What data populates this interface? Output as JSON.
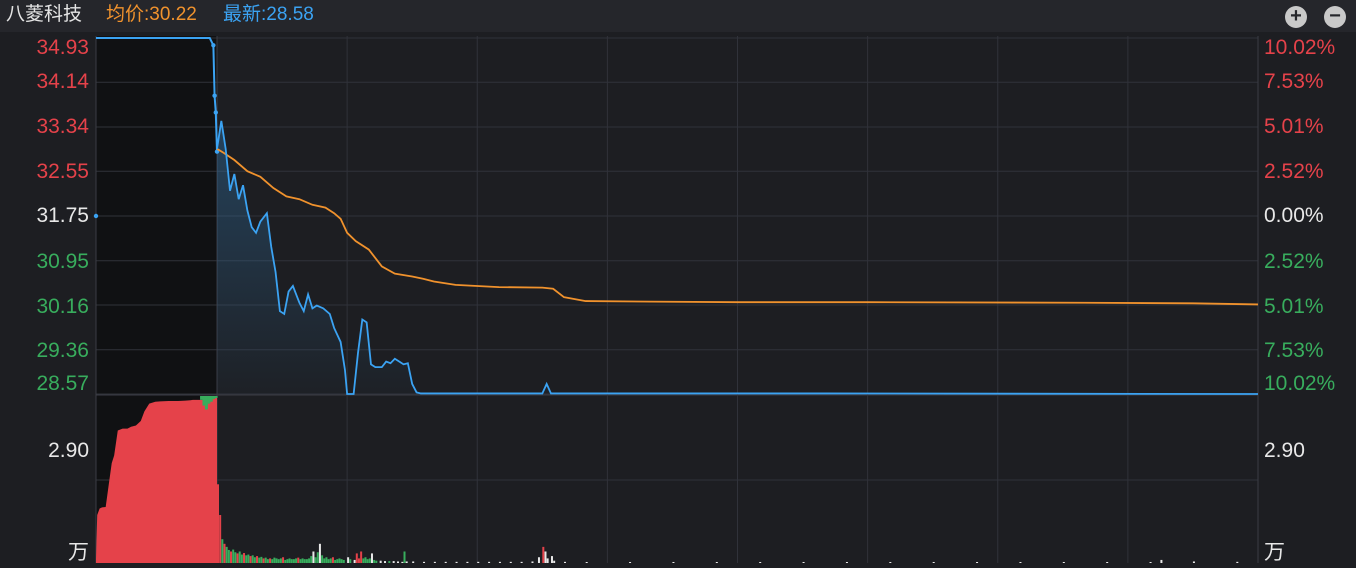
{
  "header": {
    "stock_name": "八菱科技",
    "avg_text": "均价:30.22",
    "latest_text": "最新:28.58",
    "zoom_in_symbol": "+",
    "zoom_out_symbol": "−"
  },
  "colors": {
    "background": "#1d1e22",
    "header_bg": "#25262b",
    "price_line": "#3ba3f3",
    "avg_line": "#f0922d",
    "up": "#e5424a",
    "down": "#38ad5d",
    "neutral_text": "#e8e8e8",
    "grid": "#30323a"
  },
  "chart_data": {
    "type": "line",
    "title": "",
    "ylim": [
      28.57,
      34.93
    ],
    "prev_close": 31.75,
    "price_ticks": [
      "34.93",
      "34.14",
      "33.34",
      "32.55",
      "31.75",
      "30.95",
      "30.16",
      "29.36",
      "28.57"
    ],
    "pct_ticks": [
      "10.02%",
      "7.53%",
      "5.01%",
      "2.52%",
      "0.00%",
      "2.52%",
      "5.01%",
      "7.53%",
      "10.02%"
    ],
    "volume_tick": "2.90",
    "volume_unit": "万",
    "pre_market": {
      "price_points": [
        [
          0,
          34.93
        ],
        [
          94,
          34.93
        ],
        [
          97,
          34.8
        ],
        [
          98,
          33.9
        ],
        [
          99,
          33.6
        ],
        [
          100,
          32.9
        ]
      ]
    },
    "series": [
      {
        "name": "最新",
        "points": [
          [
            0,
            32.95
          ],
          [
            2,
            33.45
          ],
          [
            4,
            32.95
          ],
          [
            6,
            32.2
          ],
          [
            8,
            32.5
          ],
          [
            10,
            32.05
          ],
          [
            12,
            32.3
          ],
          [
            14,
            31.85
          ],
          [
            16,
            31.55
          ],
          [
            18,
            31.45
          ],
          [
            20,
            31.65
          ],
          [
            23,
            31.8
          ],
          [
            25,
            31.2
          ],
          [
            27,
            30.75
          ],
          [
            29,
            30.05
          ],
          [
            31,
            30.0
          ],
          [
            33,
            30.4
          ],
          [
            35,
            30.5
          ],
          [
            37,
            30.3
          ],
          [
            38,
            30.2
          ],
          [
            40,
            30.05
          ],
          [
            42,
            30.35
          ],
          [
            44,
            30.1
          ],
          [
            46,
            30.15
          ],
          [
            49,
            30.1
          ],
          [
            52,
            30.0
          ],
          [
            54,
            29.75
          ],
          [
            57,
            29.5
          ],
          [
            59,
            29.0
          ],
          [
            60,
            28.57
          ],
          [
            63,
            28.57
          ],
          [
            65,
            29.3
          ],
          [
            67,
            29.9
          ],
          [
            69,
            29.85
          ],
          [
            71,
            29.1
          ],
          [
            73,
            29.05
          ],
          [
            76,
            29.05
          ],
          [
            78,
            29.15
          ],
          [
            80,
            29.12
          ],
          [
            82,
            29.2
          ],
          [
            84,
            29.15
          ],
          [
            86,
            29.1
          ],
          [
            88,
            29.12
          ],
          [
            90,
            28.75
          ],
          [
            92,
            28.6
          ],
          [
            94,
            28.58
          ],
          [
            150,
            28.58
          ],
          [
            152,
            28.75
          ],
          [
            154,
            28.58
          ],
          [
            278,
            28.58
          ],
          [
            480,
            28.57
          ]
        ]
      },
      {
        "name": "均价",
        "points": [
          [
            0,
            32.95
          ],
          [
            3,
            32.88
          ],
          [
            8,
            32.75
          ],
          [
            14,
            32.55
          ],
          [
            20,
            32.45
          ],
          [
            26,
            32.25
          ],
          [
            32,
            32.1
          ],
          [
            38,
            32.05
          ],
          [
            44,
            31.95
          ],
          [
            50,
            31.9
          ],
          [
            54,
            31.8
          ],
          [
            57,
            31.7
          ],
          [
            60,
            31.45
          ],
          [
            64,
            31.3
          ],
          [
            70,
            31.15
          ],
          [
            76,
            30.85
          ],
          [
            82,
            30.72
          ],
          [
            90,
            30.67
          ],
          [
            95,
            30.63
          ],
          [
            100,
            30.58
          ],
          [
            110,
            30.52
          ],
          [
            130,
            30.48
          ],
          [
            150,
            30.47
          ],
          [
            155,
            30.45
          ],
          [
            160,
            30.3
          ],
          [
            170,
            30.23
          ],
          [
            200,
            30.22
          ],
          [
            240,
            30.21
          ],
          [
            300,
            30.21
          ],
          [
            400,
            30.2
          ],
          [
            450,
            30.19
          ],
          [
            480,
            30.17
          ]
        ]
      }
    ],
    "volume": {
      "preauction_imbalance": [
        [
          0,
          0.1
        ],
        [
          1,
          1.25
        ],
        [
          3,
          1.42
        ],
        [
          5,
          1.45
        ],
        [
          8,
          1.46
        ],
        [
          11,
          2.15
        ],
        [
          13,
          2.6
        ],
        [
          15,
          2.8
        ],
        [
          18,
          3.45
        ],
        [
          22,
          3.5
        ],
        [
          26,
          3.5
        ],
        [
          29,
          3.55
        ],
        [
          33,
          3.58
        ],
        [
          37,
          3.7
        ],
        [
          40,
          3.95
        ],
        [
          44,
          4.15
        ],
        [
          49,
          4.2
        ],
        [
          53,
          4.21
        ],
        [
          60,
          4.22
        ],
        [
          68,
          4.22
        ],
        [
          74,
          4.23
        ],
        [
          78,
          4.24
        ],
        [
          80,
          4.25
        ],
        [
          84,
          4.25
        ],
        [
          88,
          4.25
        ],
        [
          90,
          4.2
        ],
        [
          92,
          4.3
        ],
        [
          94,
          4.25
        ],
        [
          96,
          4.35
        ],
        [
          100,
          4.35
        ]
      ],
      "preauction_green": [
        [
          86,
          0.1
        ],
        [
          88,
          0.25
        ],
        [
          90,
          0.35
        ],
        [
          92,
          0.2
        ],
        [
          94,
          0.15
        ],
        [
          96,
          0.08
        ],
        [
          98,
          0.05
        ]
      ],
      "bars": [
        {
          "t": 0,
          "v": 2.05,
          "dir": "up"
        },
        {
          "t": 1,
          "v": 1.25,
          "dir": "up"
        },
        {
          "t": 2,
          "v": 0.62,
          "dir": "down"
        },
        {
          "t": 3,
          "v": 0.5,
          "dir": "up"
        },
        {
          "t": 4,
          "v": 0.42,
          "dir": "down"
        },
        {
          "t": 5,
          "v": 0.34,
          "dir": "down"
        },
        {
          "t": 6,
          "v": 0.3,
          "dir": "up"
        },
        {
          "t": 7,
          "v": 0.35,
          "dir": "down"
        },
        {
          "t": 8,
          "v": 0.28,
          "dir": "down"
        },
        {
          "t": 9,
          "v": 0.25,
          "dir": "up"
        },
        {
          "t": 10,
          "v": 0.3,
          "dir": "down"
        },
        {
          "t": 11,
          "v": 0.22,
          "dir": "down"
        },
        {
          "t": 12,
          "v": 0.26,
          "dir": "up"
        },
        {
          "t": 13,
          "v": 0.2,
          "dir": "down"
        },
        {
          "t": 14,
          "v": 0.22,
          "dir": "down"
        },
        {
          "t": 15,
          "v": 0.18,
          "dir": "up"
        },
        {
          "t": 16,
          "v": 0.2,
          "dir": "down"
        },
        {
          "t": 17,
          "v": 0.15,
          "dir": "down"
        },
        {
          "t": 18,
          "v": 0.18,
          "dir": "up"
        },
        {
          "t": 19,
          "v": 0.14,
          "dir": "down"
        },
        {
          "t": 20,
          "v": 0.16,
          "dir": "down"
        },
        {
          "t": 21,
          "v": 0.12,
          "dir": "up"
        },
        {
          "t": 22,
          "v": 0.14,
          "dir": "down"
        },
        {
          "t": 23,
          "v": 0.1,
          "dir": "down"
        },
        {
          "t": 24,
          "v": 0.12,
          "dir": "up"
        },
        {
          "t": 25,
          "v": 0.1,
          "dir": "down"
        },
        {
          "t": 26,
          "v": 0.14,
          "dir": "down"
        },
        {
          "t": 27,
          "v": 0.12,
          "dir": "down"
        },
        {
          "t": 28,
          "v": 0.1,
          "dir": "down"
        },
        {
          "t": 29,
          "v": 0.12,
          "dir": "down"
        },
        {
          "t": 30,
          "v": 0.15,
          "dir": "up"
        },
        {
          "t": 31,
          "v": 0.08,
          "dir": "down"
        },
        {
          "t": 32,
          "v": 0.1,
          "dir": "down"
        },
        {
          "t": 33,
          "v": 0.12,
          "dir": "down"
        },
        {
          "t": 34,
          "v": 0.1,
          "dir": "down"
        },
        {
          "t": 35,
          "v": 0.1,
          "dir": "down"
        },
        {
          "t": 36,
          "v": 0.12,
          "dir": "down"
        },
        {
          "t": 37,
          "v": 0.14,
          "dir": "up"
        },
        {
          "t": 38,
          "v": 0.1,
          "dir": "down"
        },
        {
          "t": 39,
          "v": 0.12,
          "dir": "down"
        },
        {
          "t": 40,
          "v": 0.1,
          "dir": "down"
        },
        {
          "t": 41,
          "v": 0.1,
          "dir": "down"
        },
        {
          "t": 42,
          "v": 0.12,
          "dir": "down"
        },
        {
          "t": 43,
          "v": 0.18,
          "dir": "down"
        },
        {
          "t": 44,
          "v": 0.3,
          "dir": "flat"
        },
        {
          "t": 45,
          "v": 0.15,
          "dir": "down"
        },
        {
          "t": 46,
          "v": 0.28,
          "dir": "down"
        },
        {
          "t": 47,
          "v": 0.5,
          "dir": "flat"
        },
        {
          "t": 48,
          "v": 0.2,
          "dir": "down"
        },
        {
          "t": 49,
          "v": 0.12,
          "dir": "down"
        },
        {
          "t": 50,
          "v": 0.15,
          "dir": "down"
        },
        {
          "t": 51,
          "v": 0.1,
          "dir": "down"
        },
        {
          "t": 52,
          "v": 0.12,
          "dir": "down"
        },
        {
          "t": 53,
          "v": 0.15,
          "dir": "up"
        },
        {
          "t": 54,
          "v": 0.08,
          "dir": "down"
        },
        {
          "t": 55,
          "v": 0.1,
          "dir": "down"
        },
        {
          "t": 56,
          "v": 0.12,
          "dir": "down"
        },
        {
          "t": 57,
          "v": 0.1,
          "dir": "down"
        },
        {
          "t": 58,
          "v": 0.08,
          "dir": "down"
        },
        {
          "t": 60,
          "v": 0.15,
          "dir": "flat"
        },
        {
          "t": 61,
          "v": 0.1,
          "dir": "down"
        },
        {
          "t": 63,
          "v": 0.08,
          "dir": "flat"
        },
        {
          "t": 64,
          "v": 0.25,
          "dir": "up"
        },
        {
          "t": 65,
          "v": 0.12,
          "dir": "up"
        },
        {
          "t": 66,
          "v": 0.3,
          "dir": "up"
        },
        {
          "t": 67,
          "v": 0.12,
          "dir": "down"
        },
        {
          "t": 68,
          "v": 0.15,
          "dir": "down"
        },
        {
          "t": 69,
          "v": 0.1,
          "dir": "down"
        },
        {
          "t": 70,
          "v": 0.12,
          "dir": "down"
        },
        {
          "t": 71,
          "v": 0.25,
          "dir": "flat"
        },
        {
          "t": 72,
          "v": 0.08,
          "dir": "down"
        },
        {
          "t": 73,
          "v": 0.06,
          "dir": "down"
        },
        {
          "t": 75,
          "v": 0.06,
          "dir": "flat"
        },
        {
          "t": 77,
          "v": 0.05,
          "dir": "flat"
        },
        {
          "t": 79,
          "v": 0.05,
          "dir": "down"
        },
        {
          "t": 81,
          "v": 0.05,
          "dir": "flat"
        },
        {
          "t": 83,
          "v": 0.04,
          "dir": "flat"
        },
        {
          "t": 85,
          "v": 0.03,
          "dir": "flat"
        },
        {
          "t": 86,
          "v": 0.3,
          "dir": "down"
        },
        {
          "t": 87,
          "v": 0.04,
          "dir": "flat"
        },
        {
          "t": 90,
          "v": 0.04,
          "dir": "flat"
        },
        {
          "t": 95,
          "v": 0.03,
          "dir": "flat"
        },
        {
          "t": 100,
          "v": 0.03,
          "dir": "flat"
        },
        {
          "t": 105,
          "v": 0.03,
          "dir": "flat"
        },
        {
          "t": 110,
          "v": 0.03,
          "dir": "flat"
        },
        {
          "t": 115,
          "v": 0.03,
          "dir": "flat"
        },
        {
          "t": 120,
          "v": 0.03,
          "dir": "flat"
        },
        {
          "t": 125,
          "v": 0.03,
          "dir": "flat"
        },
        {
          "t": 130,
          "v": 0.03,
          "dir": "flat"
        },
        {
          "t": 135,
          "v": 0.03,
          "dir": "flat"
        },
        {
          "t": 140,
          "v": 0.03,
          "dir": "flat"
        },
        {
          "t": 145,
          "v": 0.04,
          "dir": "flat"
        },
        {
          "t": 148,
          "v": 0.15,
          "dir": "flat"
        },
        {
          "t": 150,
          "v": 0.42,
          "dir": "up"
        },
        {
          "t": 151,
          "v": 0.3,
          "dir": "flat"
        },
        {
          "t": 152,
          "v": 0.12,
          "dir": "flat"
        },
        {
          "t": 154,
          "v": 0.18,
          "dir": "flat"
        },
        {
          "t": 155,
          "v": 0.06,
          "dir": "flat"
        },
        {
          "t": 160,
          "v": 0.03,
          "dir": "flat"
        },
        {
          "t": 170,
          "v": 0.02,
          "dir": "flat"
        },
        {
          "t": 190,
          "v": 0.02,
          "dir": "flat"
        },
        {
          "t": 210,
          "v": 0.02,
          "dir": "flat"
        },
        {
          "t": 230,
          "v": 0.02,
          "dir": "flat"
        },
        {
          "t": 250,
          "v": 0.02,
          "dir": "flat"
        },
        {
          "t": 270,
          "v": 0.02,
          "dir": "flat"
        },
        {
          "t": 290,
          "v": 0.02,
          "dir": "flat"
        },
        {
          "t": 310,
          "v": 0.02,
          "dir": "flat"
        },
        {
          "t": 330,
          "v": 0.02,
          "dir": "flat"
        },
        {
          "t": 350,
          "v": 0.02,
          "dir": "flat"
        },
        {
          "t": 370,
          "v": 0.02,
          "dir": "flat"
        },
        {
          "t": 390,
          "v": 0.02,
          "dir": "flat"
        },
        {
          "t": 410,
          "v": 0.02,
          "dir": "flat"
        },
        {
          "t": 430,
          "v": 0.02,
          "dir": "flat"
        },
        {
          "t": 435,
          "v": 0.08,
          "dir": "flat"
        },
        {
          "t": 450,
          "v": 0.04,
          "dir": "flat"
        },
        {
          "t": 470,
          "v": 0.03,
          "dir": "flat"
        }
      ]
    }
  }
}
